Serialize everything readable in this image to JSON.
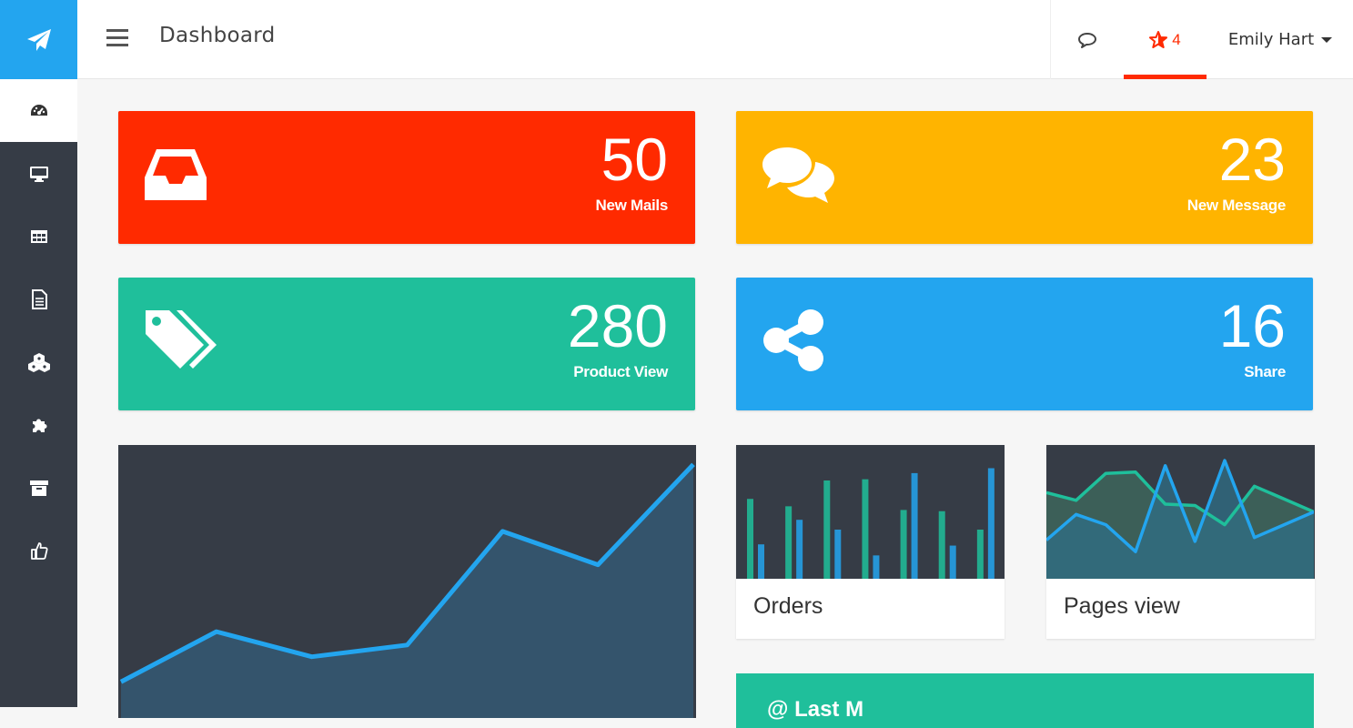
{
  "header": {
    "title": "Dashboard",
    "star_count": "4",
    "user_name": "Emily Hart"
  },
  "sidebar": {
    "items": [
      {
        "icon": "dashboard-icon"
      },
      {
        "icon": "desktop-icon"
      },
      {
        "icon": "table-icon"
      },
      {
        "icon": "document-icon"
      },
      {
        "icon": "cubes-icon"
      },
      {
        "icon": "puzzle-icon"
      },
      {
        "icon": "archive-icon"
      },
      {
        "icon": "thumbs-up-icon"
      }
    ]
  },
  "stats": [
    {
      "value": "50",
      "label": "New Mails",
      "icon": "inbox-icon",
      "color": "#ff2a00"
    },
    {
      "value": "23",
      "label": "New Message",
      "icon": "comments-icon",
      "color": "#ffb400"
    },
    {
      "value": "280",
      "label": "Product View",
      "icon": "tags-icon",
      "color": "#1fbf9b"
    },
    {
      "value": "16",
      "label": "Share",
      "icon": "share-icon",
      "color": "#23a5ef"
    }
  ],
  "orders": {
    "caption": "Orders"
  },
  "pages_view": {
    "caption": "Pages view"
  },
  "panel": {
    "title": "@ Last M"
  },
  "colors": {
    "accent_blue": "#23a5ef",
    "accent_green": "#1fbf9b",
    "dark": "#363c46"
  },
  "chart_data": [
    {
      "type": "area",
      "x": [
        1,
        2,
        3,
        4,
        5,
        6,
        7
      ],
      "values": [
        2,
        5,
        3.5,
        4.2,
        11,
        9,
        15
      ],
      "ylim": [
        0,
        16
      ]
    },
    {
      "type": "bar",
      "categories": [
        "1",
        "2",
        "3",
        "4",
        "5",
        "6",
        "7"
      ],
      "series": [
        {
          "values": [
            65,
            59,
            80,
            81,
            56,
            55,
            40
          ]
        },
        {
          "values": [
            28,
            48,
            40,
            19,
            86,
            27,
            90
          ]
        }
      ],
      "ylim": [
        0,
        100
      ]
    },
    {
      "type": "line",
      "x": [
        1,
        2,
        3,
        4,
        5,
        6,
        7,
        8,
        9,
        10
      ],
      "series": [
        {
          "values": [
            65,
            59,
            80,
            81,
            56,
            55,
            40,
            70,
            60,
            50
          ]
        },
        {
          "values": [
            28,
            48,
            40,
            19,
            86,
            27,
            90,
            30,
            40,
            50
          ]
        }
      ]
    }
  ]
}
